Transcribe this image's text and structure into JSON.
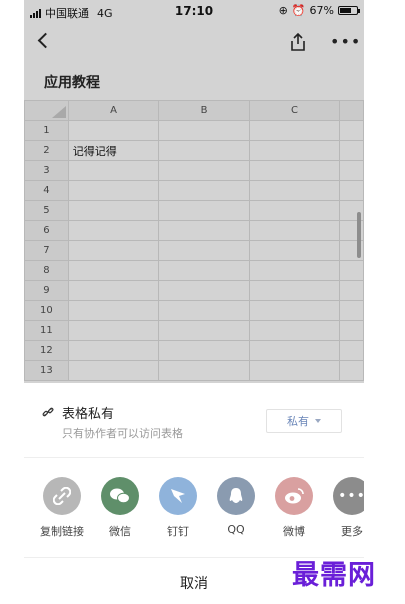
{
  "status_bar": {
    "carrier": "中国联通",
    "network": "4G",
    "time": "17:10",
    "battery": "67%",
    "battery_level": 0.67
  },
  "document": {
    "title": "应用教程"
  },
  "sheet": {
    "columns": [
      "A",
      "B",
      "C"
    ],
    "rows": [
      "1",
      "2",
      "3",
      "4",
      "5",
      "6",
      "7",
      "8",
      "9",
      "10",
      "11",
      "12",
      "13"
    ],
    "cell_a2": "记得记得"
  },
  "privacy": {
    "title": "表格私有",
    "description": "只有协作者可以访问表格",
    "select_value": "私有"
  },
  "share": {
    "items": [
      {
        "label": "复制链接",
        "icon": "link-icon",
        "color": "#b7b7b7"
      },
      {
        "label": "微信",
        "icon": "wechat-icon",
        "color": "#5f8f6a"
      },
      {
        "label": "钉钉",
        "icon": "dingtalk-icon",
        "color": "#8fb3db"
      },
      {
        "label": "QQ",
        "icon": "qq-icon",
        "color": "#8a9bb0"
      },
      {
        "label": "微博",
        "icon": "weibo-icon",
        "color": "#d9a0a0"
      },
      {
        "label": "更多",
        "icon": "more-icon",
        "color": "#8c8c8c"
      }
    ]
  },
  "cancel_label": "取消",
  "watermark": "最需网"
}
